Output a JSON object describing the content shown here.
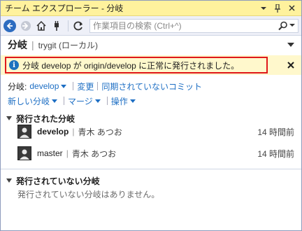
{
  "window": {
    "title": "チーム エクスプローラー - 分岐",
    "pin_glyph": "▾",
    "pin2_glyph": "ᵻ",
    "close_glyph": "✕"
  },
  "toolbar": {
    "search_placeholder": "作業項目の検索 (Ctrl+^)"
  },
  "header": {
    "title": "分岐",
    "separator": "|",
    "repo": "trygit (ローカル)"
  },
  "banner": {
    "info_glyph": "i",
    "message": "分岐 develop が origin/develop に正常に発行されました。",
    "close_glyph": "✕"
  },
  "actions": {
    "branch_label": "分岐:",
    "current_branch": "develop",
    "changes": "変更",
    "unsynced": "同期されていないコミット",
    "new_branch": "新しい分岐",
    "merge": "マージ",
    "operations": "操作"
  },
  "published": {
    "title": "発行された分岐",
    "branches": [
      {
        "name": "develop",
        "author": "青木 あつお",
        "time": "14 時間前",
        "current": true
      },
      {
        "name": "master",
        "author": "青木 あつお",
        "time": "14 時間前",
        "current": false
      }
    ]
  },
  "unpublished": {
    "title": "発行されていない分岐",
    "empty": "発行されていない分岐はありません。"
  }
}
